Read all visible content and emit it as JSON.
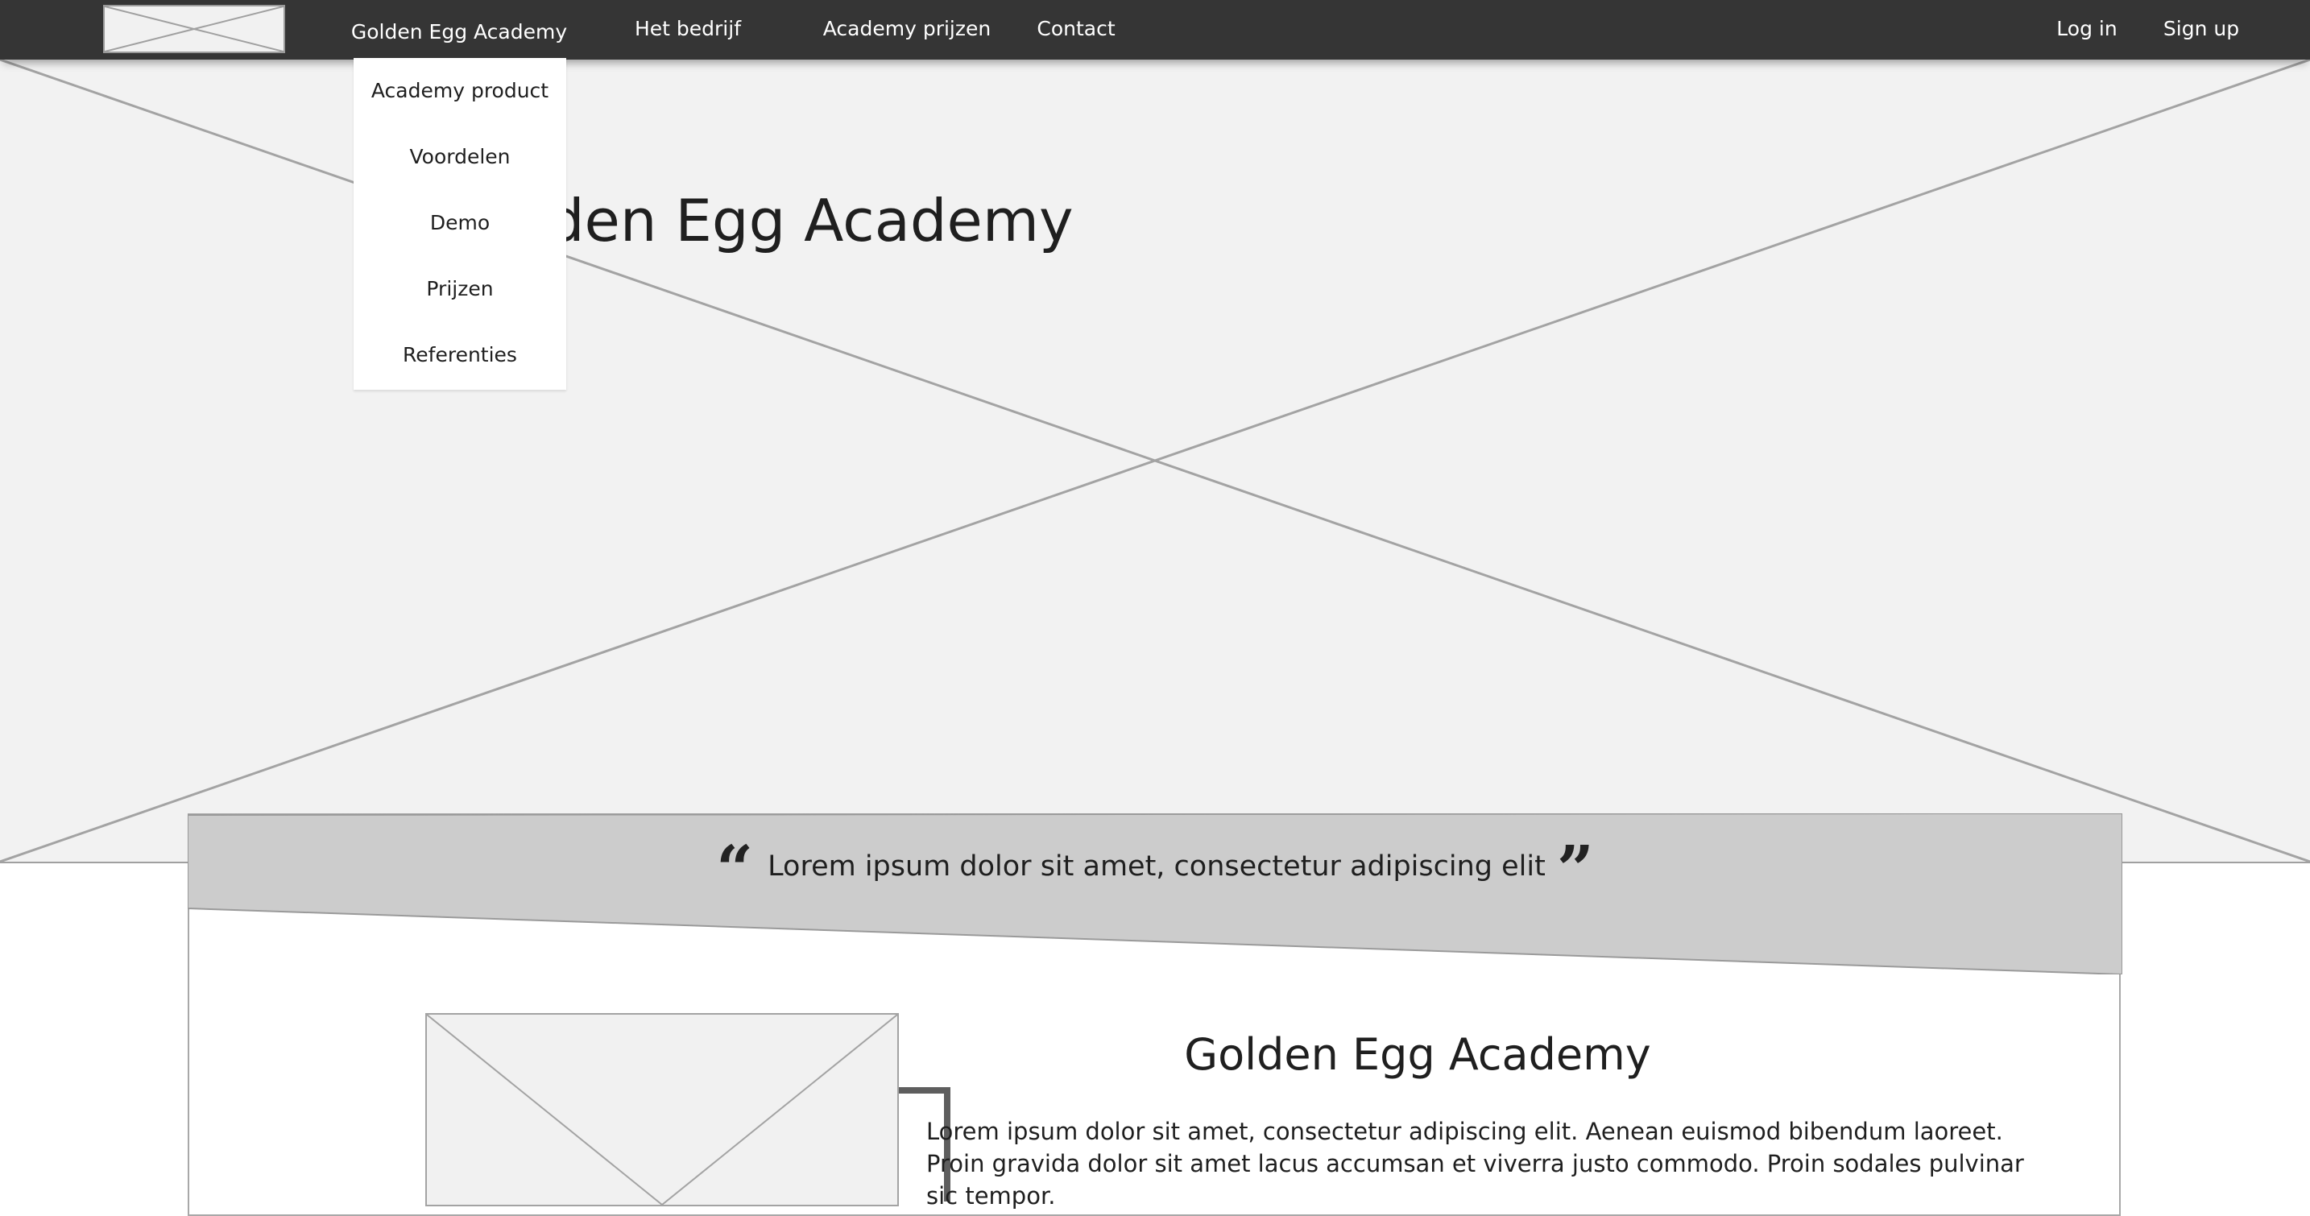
{
  "nav": {
    "logo_icon": "image-placeholder-icon",
    "items": [
      {
        "label": "Golden Egg Academy"
      },
      {
        "label": "Het bedrijf"
      },
      {
        "label": "Academy prijzen"
      },
      {
        "label": "Contact"
      }
    ],
    "login_label": "Log in",
    "signup_label": "Sign up"
  },
  "dropdown": {
    "items": [
      {
        "label": "Academy product"
      },
      {
        "label": "Voordelen"
      },
      {
        "label": "Demo"
      },
      {
        "label": "Prijzen"
      },
      {
        "label": "Referenties"
      }
    ]
  },
  "hero": {
    "title": "Golden Egg Academy",
    "background_icon": "image-placeholder-icon"
  },
  "quote": {
    "text": "Lorem ipsum dolor sit amet, consectetur adipiscing elit",
    "open_mark": "“",
    "close_mark": "”"
  },
  "feature": {
    "image_icon": "image-placeholder-icon",
    "title": "Golden Egg Academy",
    "body": "Lorem ipsum dolor sit amet, consectetur adipiscing elit. Aenean euismod bibendum laoreet. Proin gravida dolor sit amet lacus accumsan et viverra justo commodo. Proin sodales pulvinar sic tempor."
  },
  "colors": {
    "nav_bg": "#353535",
    "hero_bg": "#f2f2f2",
    "quote_bg": "#cccccc",
    "dropdown_bg": "#ffffff"
  }
}
